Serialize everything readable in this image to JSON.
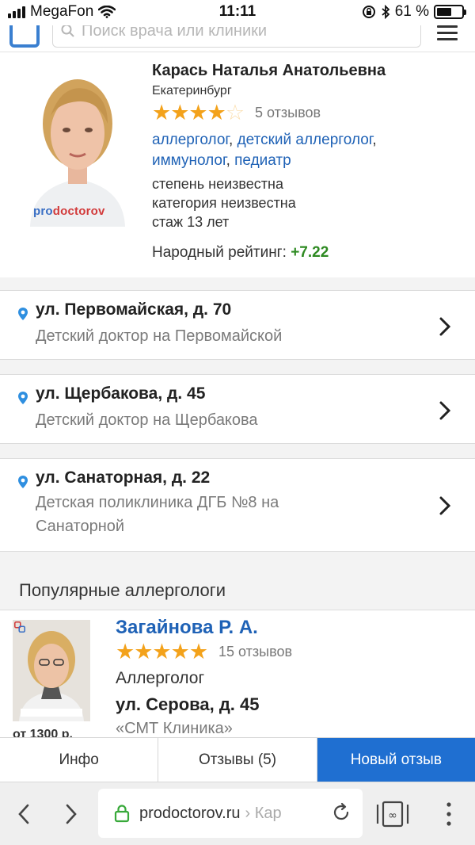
{
  "status_bar": {
    "carrier": "MegaFon",
    "time": "11:11",
    "battery": "61 %",
    "battery_level": 0.61
  },
  "header": {
    "search_placeholder": "Поиск врача или клиники"
  },
  "doctor": {
    "name": "Карась Наталья Анатольевна",
    "city": "Екатеринбург",
    "rating_stars": 4,
    "reviews": "5 отзывов",
    "specialties": [
      "аллерголог",
      "детский аллерголог",
      "иммунолог",
      "педиатр"
    ],
    "degree": "степень неизвестна",
    "category": "категория неизвестна",
    "experience": "стаж 13 лет",
    "popular_rating_label": "Народный рейтинг:",
    "popular_rating_value": "+7.22",
    "photo_watermark_a": "pro",
    "photo_watermark_b": "doctorov"
  },
  "addresses": [
    {
      "street": "ул. Первомайская, д. 70",
      "clinic": "Детский доктор на Первомайской"
    },
    {
      "street": "ул. Щербакова, д. 45",
      "clinic": "Детский доктор на Щербакова"
    },
    {
      "street": "ул. Санаторная, д. 22",
      "clinic": "Детская поликлиника ДГБ №8 на Санаторной"
    }
  ],
  "popular": {
    "heading": "Популярные аллергологи",
    "doctor": {
      "name": "Загайнова Р. А.",
      "rating_stars": 5,
      "reviews": "15 отзывов",
      "specialty": "Аллерголог",
      "address": "ул. Серова, д. 45",
      "clinic": "«СМТ Клиника»",
      "price": "от 1300 р."
    }
  },
  "tabs": [
    {
      "label": "Инфо",
      "active": false
    },
    {
      "label": "Отзывы (5)",
      "active": false
    },
    {
      "label": "Новый отзыв",
      "active": true
    }
  ],
  "browser": {
    "url": "prodoctorov.ru",
    "url_tail": "› Кар"
  },
  "colors": {
    "link_blue": "#1f62b6",
    "star_orange": "#f3a21b",
    "rating_green": "#2e8a22",
    "active_tab": "#1f6fd1"
  }
}
